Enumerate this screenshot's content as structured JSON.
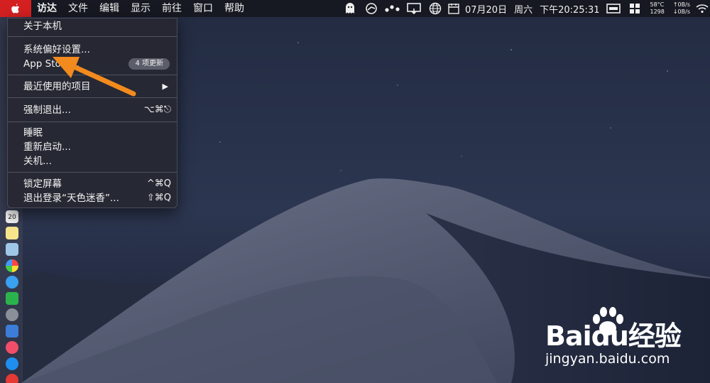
{
  "menubar": {
    "app_name": "访达",
    "menus": [
      "文件",
      "编辑",
      "显示",
      "前往",
      "窗口",
      "帮助"
    ],
    "date": "07月20日",
    "weekday": "周六",
    "time": "下午20:25:31",
    "temp": "58°C",
    "fan": "1298",
    "net_up": "↑0B/s",
    "net_down": "↓0B/s"
  },
  "apple_menu": {
    "about": "关于本机",
    "system_prefs": "系统偏好设置...",
    "app_store": "App Store...",
    "app_store_badge": "4 项更新",
    "recent_items": "最近使用的项目",
    "recent_arrow": "▶",
    "force_quit": "强制退出...",
    "force_quit_shortcut": "⌥⌘⎋",
    "sleep": "睡眠",
    "restart": "重新启动...",
    "shutdown": "关机...",
    "lock_screen": "锁定屏幕",
    "lock_screen_shortcut": "^⌘Q",
    "logout": "退出登录“天色迷香”...",
    "logout_shortcut": "⇧⌘Q"
  },
  "dock": {
    "calendar_day": "20"
  },
  "watermark": {
    "logo": "Baidu经验",
    "url": "jingyan.baidu.com"
  },
  "colors": {
    "apple_highlight": "#d42020",
    "annotation_arrow": "#f28a1e"
  }
}
